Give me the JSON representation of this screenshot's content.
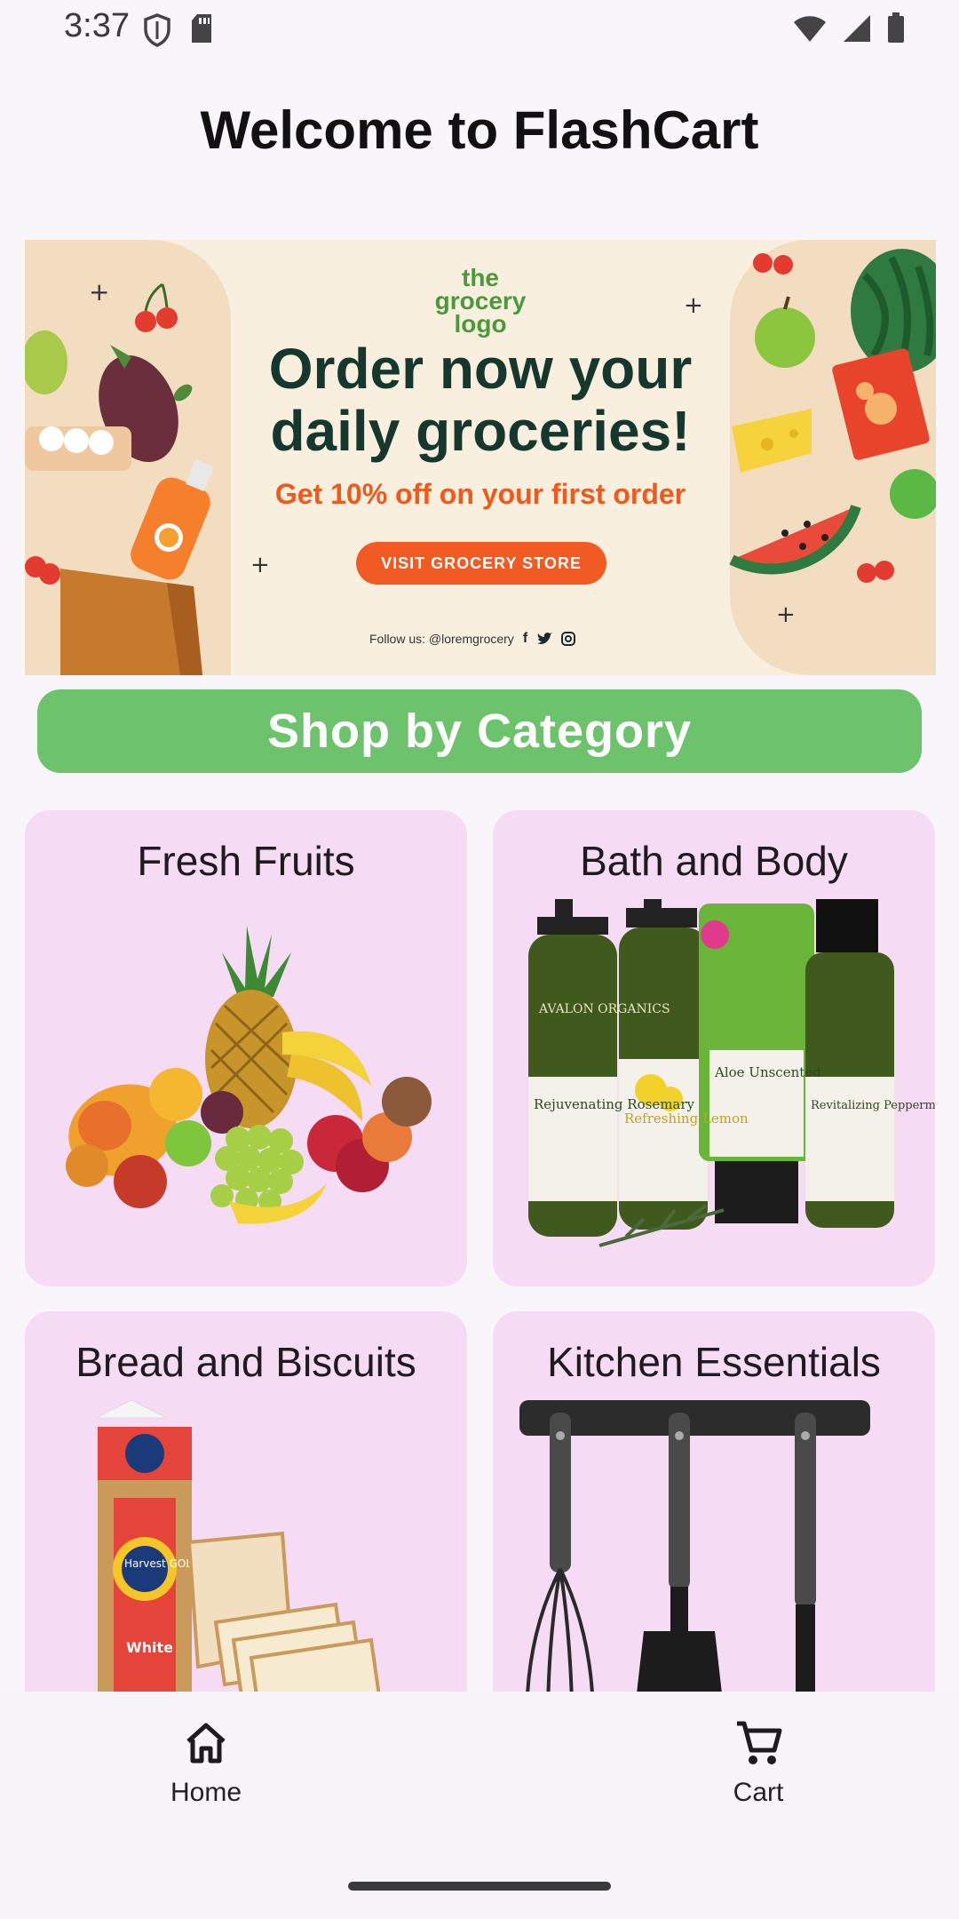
{
  "status_bar": {
    "time": "3:37"
  },
  "header": {
    "title": "Welcome to FlashCart"
  },
  "banner": {
    "logo_lines": [
      "the",
      "grocery",
      "logo"
    ],
    "headline_line1": "Order now your",
    "headline_line2": "daily groceries!",
    "subtitle": "Get 10% off on your first order",
    "button_label": "VISIT GROCERY STORE",
    "follow_text": "Follow us: @loremgrocery",
    "colors": {
      "background": "#f8efdf",
      "headline": "#15372e",
      "accent": "#ee5a1e",
      "logo": "#4a9a3a"
    }
  },
  "shop_category": {
    "label": "Shop by Category",
    "color": "#6dc36c"
  },
  "categories": [
    {
      "label": "Fresh Fruits",
      "icon": "fruits-image"
    },
    {
      "label": "Bath and Body",
      "icon": "bath-products-image"
    },
    {
      "label": "Bread and Biscuits",
      "icon": "bread-image"
    },
    {
      "label": "Kitchen Essentials",
      "icon": "kitchen-utensils-image"
    }
  ],
  "bath_products": {
    "brand": "AVALON ORGANICS",
    "products": [
      "Rejuvenating Rosemary",
      "Refreshing Lemon",
      "Aloe Unscented",
      "Revitalizing Peppermint"
    ]
  },
  "bread_product": {
    "brand": "Harvest GOLD",
    "variant": "White"
  },
  "bottom_nav": {
    "items": [
      {
        "label": "Home",
        "icon": "home-icon"
      },
      {
        "label": "Cart",
        "icon": "cart-icon"
      }
    ]
  }
}
